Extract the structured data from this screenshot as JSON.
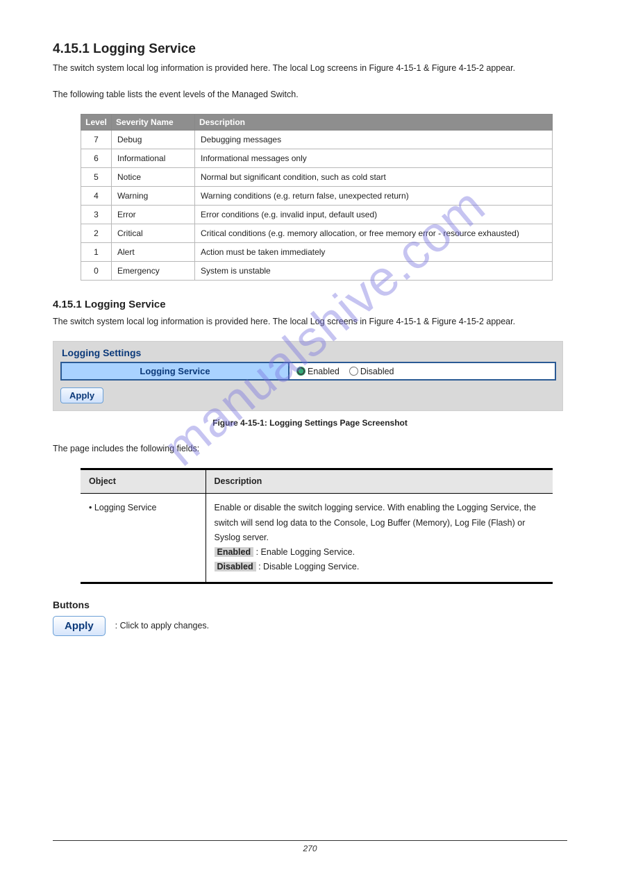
{
  "watermark": "manualshive.com",
  "section_title": "4.15.1 Logging Service",
  "intro": "The switch system local log information is provided here. The local Log screens in Figure 4-15-1 & Figure 4-15-2 appear.",
  "severity_intro": "The following table lists the event levels of the Managed Switch.",
  "severity_table": {
    "headers": [
      "Level",
      "Severity Name",
      "Description"
    ],
    "rows": [
      [
        "7",
        "Debug",
        "Debugging messages"
      ],
      [
        "6",
        "Informational",
        "Informational messages only"
      ],
      [
        "5",
        "Notice",
        "Normal but significant condition, such as cold start"
      ],
      [
        "4",
        "Warning",
        "Warning conditions (e.g. return false, unexpected return)"
      ],
      [
        "3",
        "Error",
        "Error conditions (e.g. invalid input, default used)"
      ],
      [
        "2",
        "Critical",
        "Critical conditions (e.g. memory allocation, or free memory error - resource exhausted)"
      ],
      [
        "1",
        "Alert",
        "Action must be taken immediately"
      ],
      [
        "0",
        "Emergency",
        "System is unstable"
      ]
    ]
  },
  "ui_panel": {
    "title": "Logging Settings",
    "row_label": "Logging Service",
    "enabled": "Enabled",
    "disabled": "Disabled",
    "apply": "Apply"
  },
  "figcap1": "Figure 4-15-1: Logging Settings Page Screenshot",
  "obj_intro": "The page includes the following fields:",
  "obj_table": {
    "hdr_object": "Object",
    "hdr_desc": "Description",
    "row_obj": "• Logging Service",
    "row_desc_prefix": "Enable or disable the switch logging service. With enabling the Logging Service, the switch will send log data to the Console, Log Buffer (Memory), Log File (Flash) or Syslog server.",
    "opt_enabled": "Enabled",
    "opt_enabled_desc": ": Enable Logging Service.",
    "opt_disabled": "Disabled",
    "opt_disabled_desc": ": Disable Logging Service."
  },
  "buttons_label": "Buttons",
  "apply_btn": "Apply",
  "apply_desc": ": Click to apply changes.",
  "page_number": "270"
}
